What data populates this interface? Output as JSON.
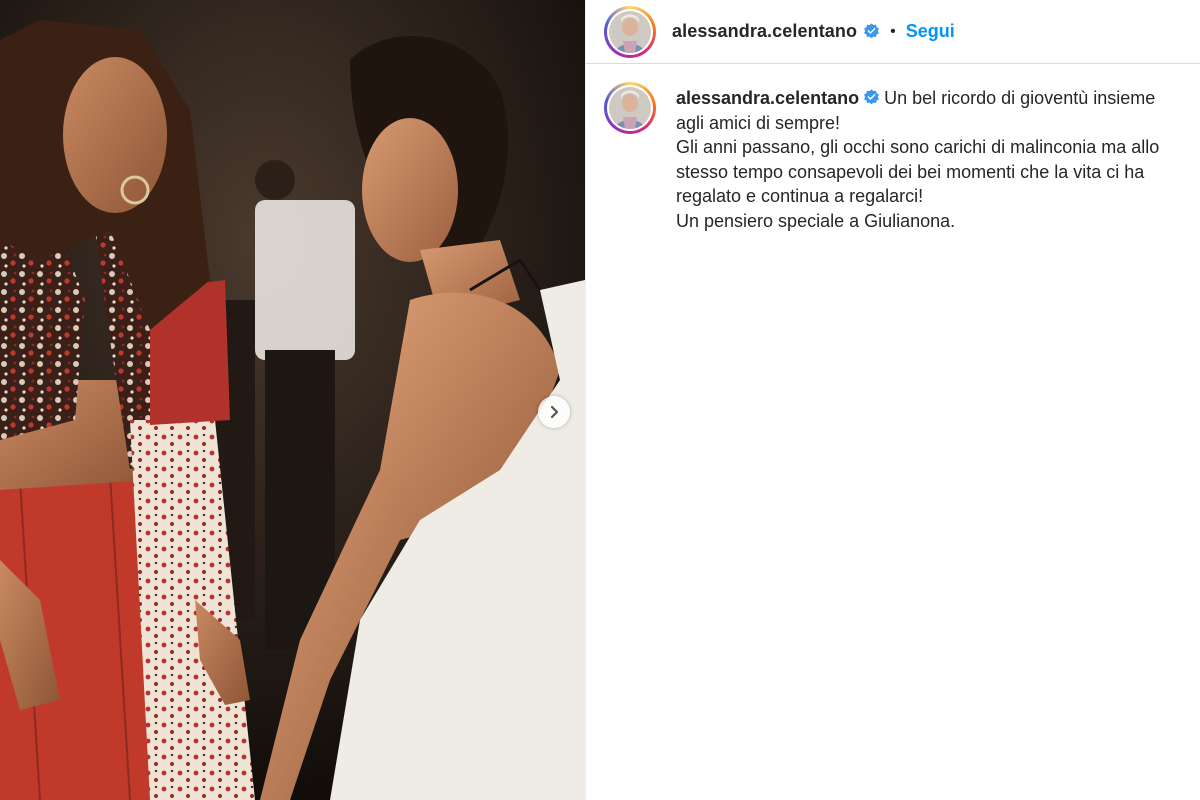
{
  "post": {
    "username": "alessandra.celentano",
    "follow_label": "Segui",
    "separator": "•",
    "caption_lines": [
      "Un bel ricordo di gioventù insieme agli amici di sempre!",
      "Gli anni passano, gli occhi sono carichi di malinconia ma allo stesso tempo consapevoli dei bei momenti che la vita ci ha regalato e continua a regalarci!",
      "Un pensiero speciale a Giulianona."
    ]
  },
  "icons": {
    "verified": "verified-badge-icon",
    "next": "chevron-right-icon"
  },
  "colors": {
    "link_blue": "#0095f6",
    "verified_blue": "#3897f0",
    "text": "#262626",
    "divider": "#dbdbdb"
  }
}
